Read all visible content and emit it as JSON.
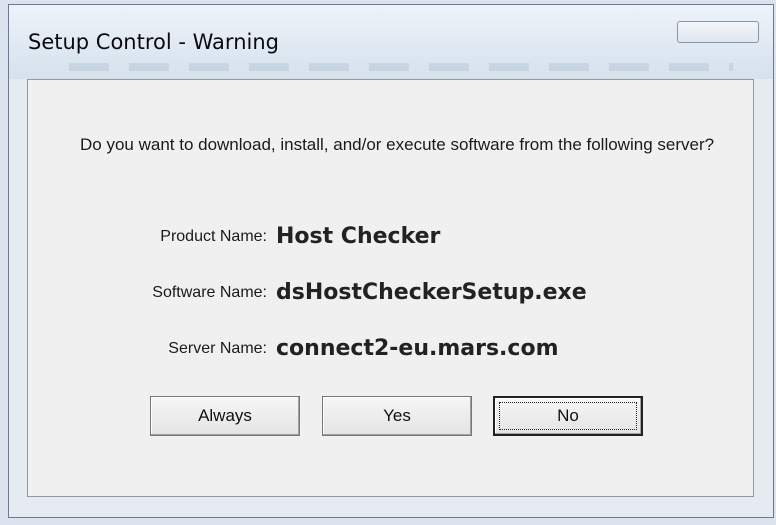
{
  "window": {
    "title": "Setup Control - Warning"
  },
  "dialog": {
    "question": "Do you want to download, install, and/or execute software from the following server?",
    "fields": [
      {
        "label": "Product Name:",
        "value": "Host Checker"
      },
      {
        "label": "Software Name:",
        "value": "dsHostCheckerSetup.exe"
      },
      {
        "label": "Server Name:",
        "value": "connect2-eu.mars.com"
      }
    ]
  },
  "buttons": {
    "always": "Always",
    "yes": "Yes",
    "no": "No",
    "focused": "no"
  }
}
